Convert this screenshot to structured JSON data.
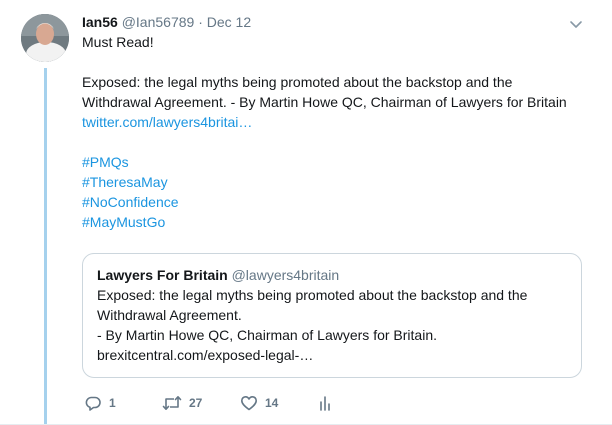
{
  "author": {
    "name": "Ian56",
    "handle": "@Ian56789",
    "separator": "·",
    "date": "Dec 12",
    "avatar_icon": "user-avatar-photo"
  },
  "tweet": {
    "lines": [
      "Must Read!",
      "Exposed: the legal myths being promoted about the backstop and the",
      "Withdrawal Agreement. - By Martin Howe QC, Chairman of Lawyers for Britain"
    ],
    "link": "twitter.com/lawyers4britai…",
    "hashtags": [
      "#PMQs",
      "#TheresaMay",
      "#NoConfidence",
      "#MayMustGo"
    ]
  },
  "quoted_tweet": {
    "name": "Lawyers For Britain",
    "handle": "@lawyers4britain",
    "lines": [
      "Exposed: the legal myths being promoted about the backstop and the",
      "Withdrawal Agreement.",
      "- By Martin Howe QC, Chairman of Lawyers for Britain.",
      "brexitcentral.com/exposed-legal-…"
    ]
  },
  "actions": {
    "reply_count": "1",
    "retweet_count": "27",
    "like_count": "14",
    "icons": [
      "reply-icon",
      "retweet-icon",
      "like-icon",
      "analytics-icon"
    ]
  },
  "colors": {
    "link": "#1b95e0",
    "secondary_text": "#657786",
    "thread_line": "#a5d1ed",
    "border": "#ccd6dd"
  }
}
